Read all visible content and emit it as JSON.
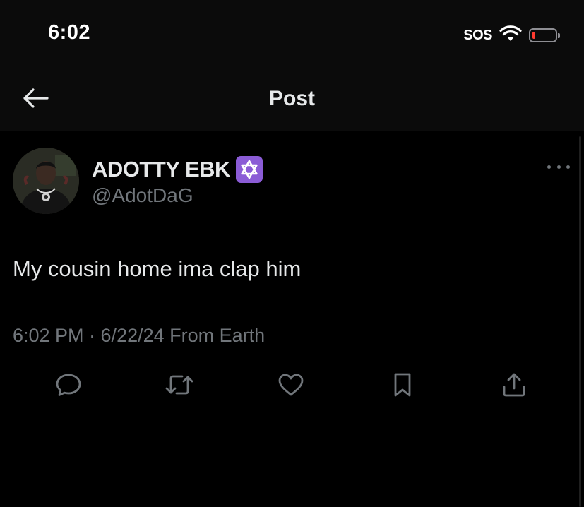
{
  "status_bar": {
    "time": "6:02",
    "sos": "SOS",
    "battery_level": 0.12,
    "battery_color": "#ff3b30"
  },
  "nav": {
    "back_icon": "arrow-left-icon",
    "title": "Post"
  },
  "post": {
    "author": {
      "display_name": "ADOTTY EBK",
      "badge_icon": "star-of-david-emoji",
      "handle": "@AdotDaG"
    },
    "more_icon": "ellipsis-icon",
    "text": "My cousin home ima clap him",
    "meta": "6:02 PM · 6/22/24 From Earth",
    "actions": [
      {
        "name": "reply",
        "icon": "comment-icon"
      },
      {
        "name": "repost",
        "icon": "repost-icon"
      },
      {
        "name": "like",
        "icon": "heart-icon"
      },
      {
        "name": "bookmark",
        "icon": "bookmark-icon"
      },
      {
        "name": "share",
        "icon": "share-icon"
      }
    ]
  },
  "colors": {
    "background": "#000000",
    "header_background": "#0b0b0b",
    "primary_text": "#e7e9ea",
    "secondary_text": "#71767b",
    "badge_purple": "#8b5cd6"
  }
}
